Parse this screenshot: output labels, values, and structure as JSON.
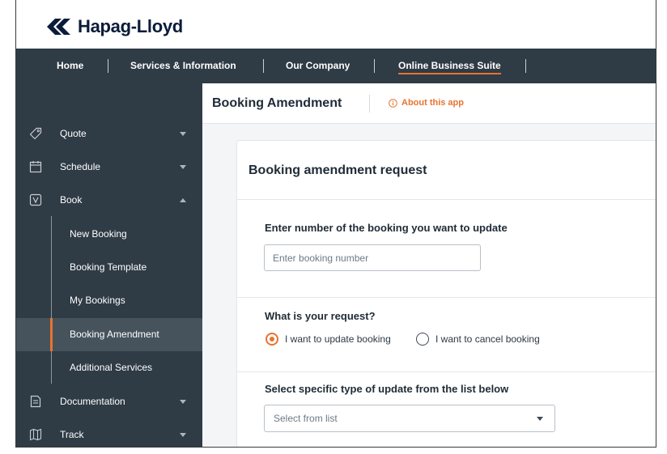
{
  "brand": {
    "name": "Hapag-Lloyd"
  },
  "topnav": {
    "items": [
      {
        "label": "Home",
        "active": false
      },
      {
        "label": "Services & Information",
        "active": false
      },
      {
        "label": "Our Company",
        "active": false
      },
      {
        "label": "Online Business Suite",
        "active": true
      }
    ]
  },
  "sidebar": {
    "items": [
      {
        "label": "Quote",
        "icon": "tag-icon",
        "expanded": false
      },
      {
        "label": "Schedule",
        "icon": "calendar-icon",
        "expanded": false
      },
      {
        "label": "Book",
        "icon": "book-icon",
        "expanded": true
      },
      {
        "label": "Documentation",
        "icon": "document-icon",
        "expanded": false
      },
      {
        "label": "Track",
        "icon": "map-pin-icon",
        "expanded": false
      }
    ],
    "book_subitems": [
      {
        "label": "New Booking",
        "active": false
      },
      {
        "label": "Booking Template",
        "active": false
      },
      {
        "label": "My Bookings",
        "active": false
      },
      {
        "label": "Booking Amendment",
        "active": true
      },
      {
        "label": "Additional Services",
        "active": false
      }
    ]
  },
  "page": {
    "title": "Booking Amendment",
    "about_link": "About this app"
  },
  "form": {
    "title": "Booking amendment request",
    "booking_number": {
      "label": "Enter number of the booking you want to update",
      "value": "",
      "placeholder": "Enter booking number"
    },
    "request": {
      "label": "What is your request?",
      "options": [
        {
          "label": "I want to update booking",
          "selected": true
        },
        {
          "label": "I want to cancel booking",
          "selected": false
        }
      ]
    },
    "update_type": {
      "label": "Select specific type of update from the list below",
      "placeholder": "Select from list"
    }
  },
  "colors": {
    "accent": "#e8732f",
    "nav_bg": "#2f3b45",
    "active_bg": "#46535d",
    "brand_blue": "#0b1b3a"
  }
}
